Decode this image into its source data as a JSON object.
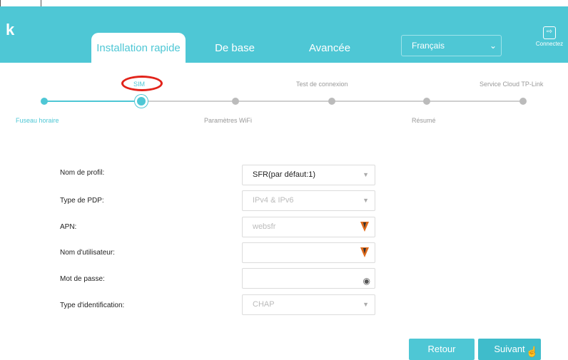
{
  "header": {
    "logo": "k",
    "tabs": [
      {
        "label": "Installation rapide",
        "active": true
      },
      {
        "label": "De base",
        "active": false
      },
      {
        "label": "Avancée",
        "active": false
      }
    ],
    "language": {
      "selected": "Français"
    },
    "connect_label": "Connectez"
  },
  "steps": {
    "top": [
      "SIM",
      "Test de connexion",
      "Service Cloud TP-Link"
    ],
    "bottom": [
      "Fuseau horaire",
      "Paramètres WiFi",
      "Résumé"
    ]
  },
  "form": {
    "fields": [
      {
        "label": "Nom de profil:",
        "value": "SFR(par défaut:1)",
        "type": "select"
      },
      {
        "label": "Type de PDP:",
        "value": "IPv4 & IPv6",
        "type": "select"
      },
      {
        "label": "APN:",
        "value": "websfr",
        "type": "text"
      },
      {
        "label": "Nom d'utilisateur:",
        "value": "",
        "type": "text"
      },
      {
        "label": "Mot de passe:",
        "value": "",
        "type": "password"
      },
      {
        "label": "Type d'identification:",
        "value": "CHAP",
        "type": "select"
      }
    ]
  },
  "buttons": {
    "back": "Retour",
    "next": "Suivant"
  },
  "colors": {
    "accent": "#4ec7d5",
    "highlight": "#e2231a"
  },
  "icons": {
    "marker": "warning-marker-icon",
    "eye": "eye-icon",
    "logout": "logout-icon"
  }
}
